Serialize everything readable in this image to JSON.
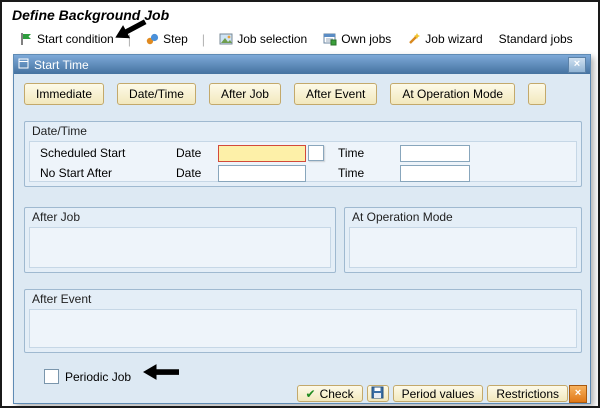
{
  "window": {
    "title": "Define Background Job"
  },
  "toolbar": {
    "items": [
      {
        "label": "Start condition",
        "icon": "flag-icon"
      },
      {
        "label": "Step",
        "icon": "step-icon"
      },
      {
        "label": "Job selection",
        "icon": "photo-icon"
      },
      {
        "label": "Own jobs",
        "icon": "own-jobs-icon"
      },
      {
        "label": "Job wizard",
        "icon": "wizard-icon"
      },
      {
        "label": "Standard jobs",
        "icon": ""
      }
    ]
  },
  "dialog": {
    "title": "Start Time",
    "close": "×",
    "tabs": [
      {
        "label": "Immediate"
      },
      {
        "label": "Date/Time"
      },
      {
        "label": "After Job"
      },
      {
        "label": "After Event"
      },
      {
        "label": "At Operation Mode"
      },
      {
        "label": ""
      }
    ],
    "datetime_group": {
      "title": "Date/Time",
      "rows": [
        {
          "label": "Scheduled Start",
          "date_label": "Date",
          "date_value": "",
          "time_label": "Time",
          "time_value": ""
        },
        {
          "label": "No Start After",
          "date_label": "Date",
          "date_value": "",
          "time_label": "Time",
          "time_value": ""
        }
      ]
    },
    "after_job_group": {
      "title": "After Job"
    },
    "operation_mode_group": {
      "title": "At Operation Mode"
    },
    "after_event_group": {
      "title": "After Event"
    },
    "periodic_job": {
      "label": "Periodic Job",
      "checked": false
    },
    "footer": {
      "check": "Check",
      "period_values": "Period values",
      "restrictions": "Restrictions",
      "close": "×"
    }
  },
  "colors": {
    "titlebar_start": "#7da9d8",
    "titlebar_end": "#45729f",
    "button_face": "#f2e8bd",
    "focus_field_bg": "#fdf0a8",
    "focus_field_border": "#d34a3a",
    "dialog_bg": "#dde9f3"
  }
}
